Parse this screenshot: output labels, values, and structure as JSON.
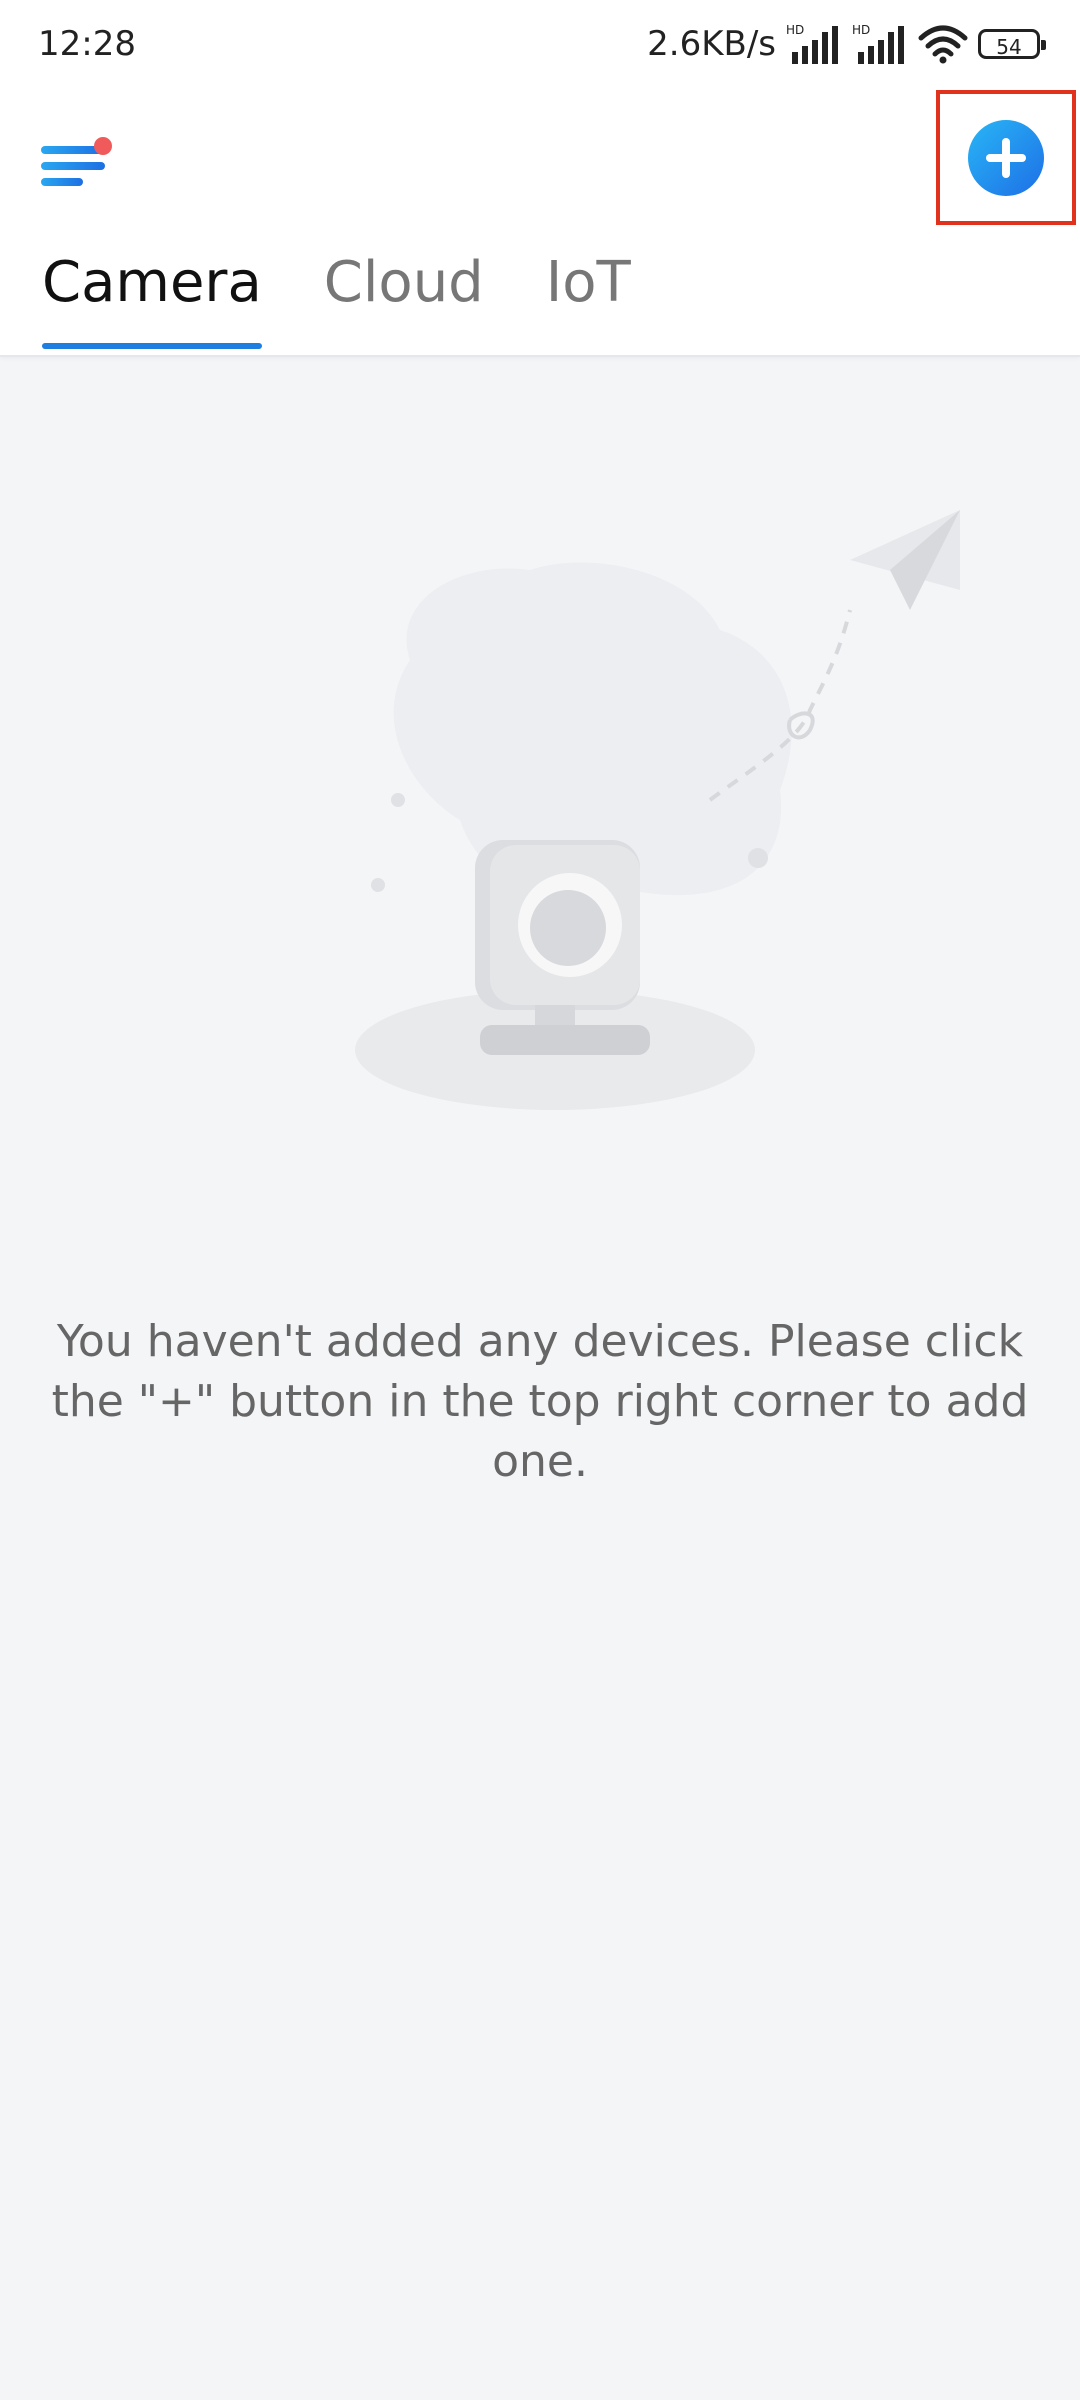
{
  "status_bar": {
    "time": "12:28",
    "net_speed": "2.6KB/s",
    "signal_badge": "HD",
    "battery_level": "54"
  },
  "header": {
    "menu_icon": "menu-icon",
    "add_icon": "add-icon"
  },
  "tabs": [
    {
      "label": "Camera",
      "active": true
    },
    {
      "label": "Cloud",
      "active": false
    },
    {
      "label": "IoT",
      "active": false
    }
  ],
  "empty_state": {
    "message": "You haven't added any devices. Please click the \"+\" button in the top right corner to add one."
  },
  "colors": {
    "accent": "#1f7fe0",
    "notification_dot": "#f05a5a",
    "highlight_box": "#e0321d"
  }
}
